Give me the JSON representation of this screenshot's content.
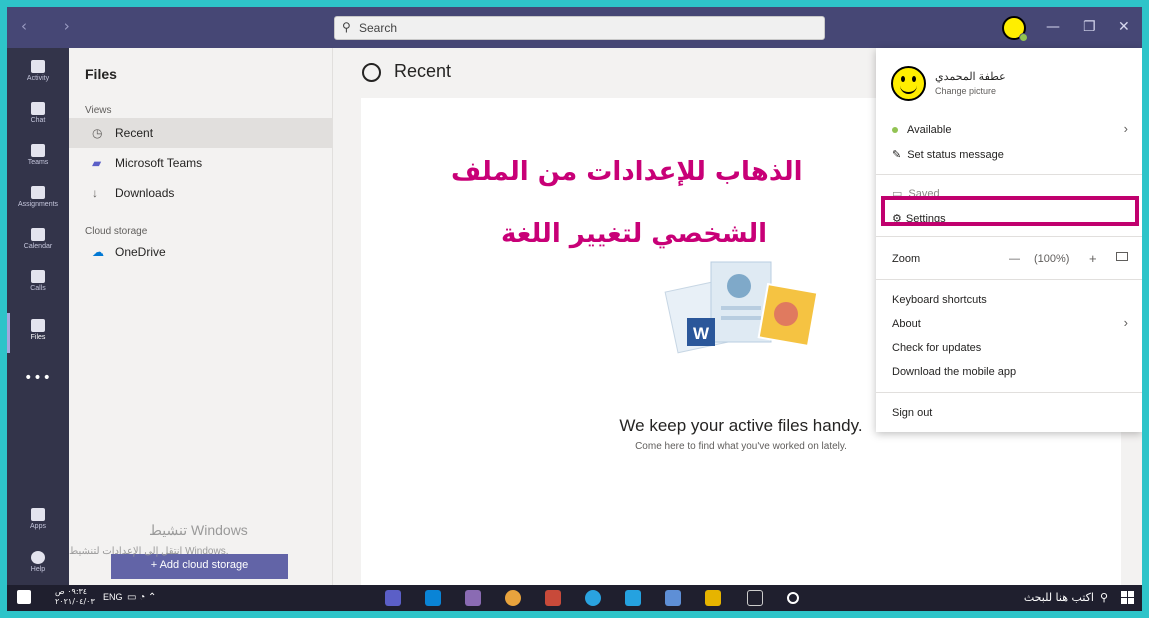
{
  "titlebar": {
    "search_placeholder": "Search",
    "nav_arrows": "‹ ›",
    "min": "—",
    "max": "❐",
    "close": "✕"
  },
  "appbar": [
    {
      "label": "Activity",
      "icon": "bell-icon"
    },
    {
      "label": "Chat",
      "icon": "chat-icon"
    },
    {
      "label": "Teams",
      "icon": "teams-icon"
    },
    {
      "label": "Assignments",
      "icon": "assignments-icon"
    },
    {
      "label": "Calendar",
      "icon": "calendar-icon"
    },
    {
      "label": "Calls",
      "icon": "phone-icon"
    },
    {
      "label": "Files",
      "icon": "files-icon",
      "active": true
    }
  ],
  "appbar_bottom": [
    {
      "label": "Apps",
      "icon": "apps-icon"
    },
    {
      "label": "Help",
      "icon": "help-icon"
    }
  ],
  "filepane": {
    "title": "Files",
    "views_label": "Views",
    "views": [
      "Recent",
      "Microsoft Teams",
      "Downloads"
    ],
    "cloud_label": "Cloud storage",
    "cloud": [
      "OneDrive"
    ],
    "add_storage": "+  Add cloud storage",
    "watermark_title": "تنشيط Windows",
    "watermark_sub": "انتقل إلى الإعدادات لتنشيط Windows."
  },
  "main": {
    "title": "Recent",
    "empty_heading": "We keep your active files handy.",
    "empty_sub": "Come here to find what you've worked on lately.",
    "annotation_line1": "الذهاب للإعدادات من الملف",
    "annotation_line2": "الشخصي لتغيير اللغة",
    "annotation_color": "#c80077"
  },
  "menu": {
    "user_name": "عطفة المحمدي",
    "change_picture": "Change picture",
    "available": "Available",
    "set_status": "Set status message",
    "saved": "Saved",
    "settings": "Settings",
    "zoom_label": "Zoom",
    "zoom_minus": "—",
    "zoom_value": "(100%)",
    "zoom_plus": "+",
    "keyboard_shortcuts": "Keyboard shortcuts",
    "about": "About",
    "check_updates": "Check for updates",
    "download_mobile": "Download the mobile app",
    "sign_out": "Sign out",
    "highlight_color": "#c0006e"
  },
  "taskbar": {
    "search_text": "اكتب هنا للبحث",
    "lang": "ENG",
    "time": "٠٩:٣٤ ص",
    "date": "٢٠٢١/٠٤/٠٣"
  }
}
